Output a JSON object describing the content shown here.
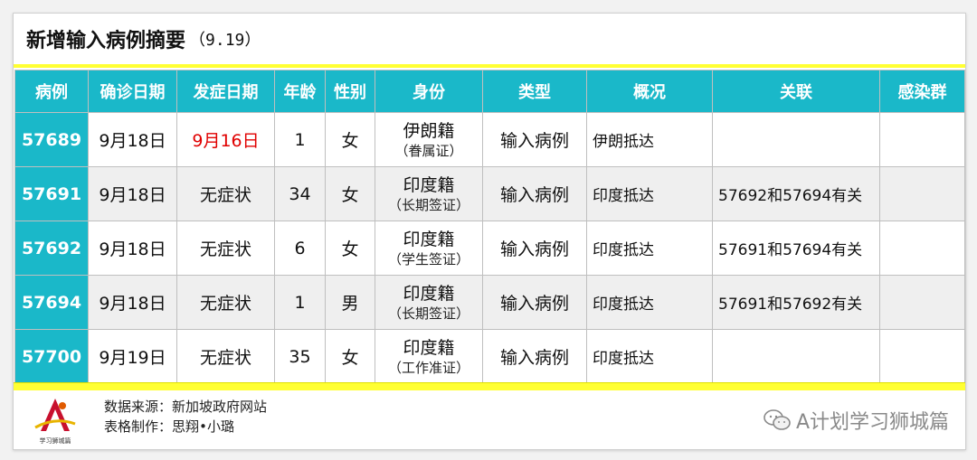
{
  "title": {
    "main": "新增输入病例摘要",
    "date": "（9.19）"
  },
  "headers": [
    "病例",
    "确诊日期",
    "发症日期",
    "年龄",
    "性别",
    "身份",
    "类型",
    "概况",
    "关联",
    "感染群"
  ],
  "rows": [
    {
      "case": "57689",
      "confirm": "9月18日",
      "onset": "9月16日",
      "onset_red": true,
      "age": "1",
      "sex": "女",
      "id_main": "伊朗籍",
      "id_sub": "（眷属证）",
      "type": "输入病例",
      "summary": "伊朗抵达",
      "related": "",
      "cluster": ""
    },
    {
      "case": "57691",
      "confirm": "9月18日",
      "onset": "无症状",
      "age": "34",
      "sex": "女",
      "id_main": "印度籍",
      "id_sub": "（长期签证）",
      "type": "输入病例",
      "summary": "印度抵达",
      "related": "57692和57694有关",
      "cluster": ""
    },
    {
      "case": "57692",
      "confirm": "9月18日",
      "onset": "无症状",
      "age": "6",
      "sex": "女",
      "id_main": "印度籍",
      "id_sub": "（学生签证）",
      "type": "输入病例",
      "summary": "印度抵达",
      "related": "57691和57694有关",
      "cluster": ""
    },
    {
      "case": "57694",
      "confirm": "9月18日",
      "onset": "无症状",
      "age": "1",
      "sex": "男",
      "id_main": "印度籍",
      "id_sub": "（长期签证）",
      "type": "输入病例",
      "summary": "印度抵达",
      "related": "57691和57692有关",
      "cluster": ""
    },
    {
      "case": "57700",
      "confirm": "9月19日",
      "onset": "无症状",
      "age": "35",
      "sex": "女",
      "id_main": "印度籍",
      "id_sub": "（工作准证）",
      "type": "输入病例",
      "summary": "印度抵达",
      "related": "",
      "cluster": ""
    }
  ],
  "footer": {
    "source": "数据来源：新加坡政府网站",
    "maker": "表格制作：思翔•小璐",
    "brand": "A计划学习狮城篇",
    "logo_text": "学习狮城篇"
  },
  "colors": {
    "header": "#1ab8c9",
    "accent": "#ffff33",
    "onset_highlight": "#e00000"
  },
  "icons": {
    "logo": "lion-city-logo",
    "brand": "wechat-icon"
  }
}
